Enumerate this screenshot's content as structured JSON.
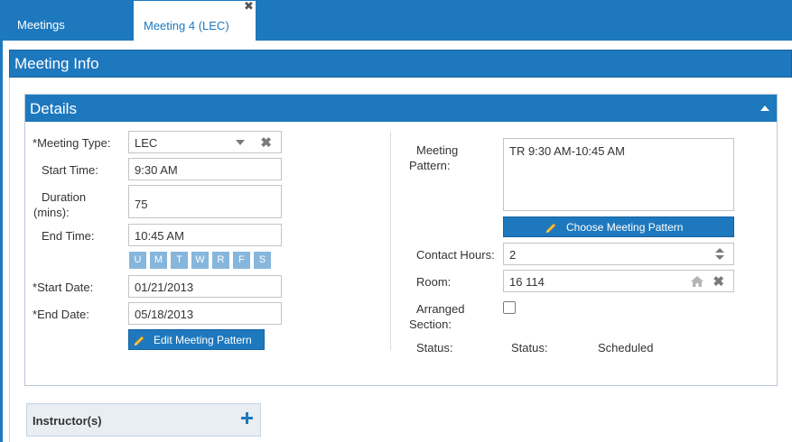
{
  "tabs": [
    {
      "label": "Meetings"
    },
    {
      "label": "Meeting 4 (LEC)",
      "close": "✖"
    }
  ],
  "meeting_info": {
    "title": "Meeting Info"
  },
  "details": {
    "title": "Details",
    "required_mark": "*",
    "meeting_type": {
      "label": "Meeting Type:",
      "value": "LEC",
      "clear": "✖"
    },
    "start_time": {
      "label": "Start Time:",
      "value": "9:30 AM"
    },
    "duration": {
      "label_line1": "Duration",
      "label_line2": "(mins):",
      "value": "75"
    },
    "end_time": {
      "label": "End Time:",
      "value": "10:45 AM"
    },
    "days": [
      "U",
      "M",
      "T",
      "W",
      "R",
      "F",
      "S"
    ],
    "start_date": {
      "label": "Start Date:",
      "value": "01/21/2013"
    },
    "end_date": {
      "label": "End Date:",
      "value": "05/18/2013"
    },
    "edit_pattern_button": "Edit Meeting Pattern",
    "meeting_pattern": {
      "label_line1": "Meeting",
      "label_line2": "Pattern:",
      "value": "TR 9:30 AM-10:45 AM"
    },
    "choose_pattern_button": "Choose Meeting Pattern",
    "contact_hours": {
      "label": "Contact Hours:",
      "value": "2"
    },
    "room": {
      "label": "Room:",
      "value": "16 114",
      "clear": "✖"
    },
    "arranged_section": {
      "label_line1": "Arranged",
      "label_line2": "Section:",
      "checked": false
    },
    "status": {
      "label": "Status:",
      "label2": "Status:",
      "value": "Scheduled"
    }
  },
  "instructors": {
    "title": "Instructor(s)"
  },
  "colors": {
    "primary": "#1e78be",
    "day_button": "#87b6dc",
    "panel_bg": "#e9eef3"
  }
}
